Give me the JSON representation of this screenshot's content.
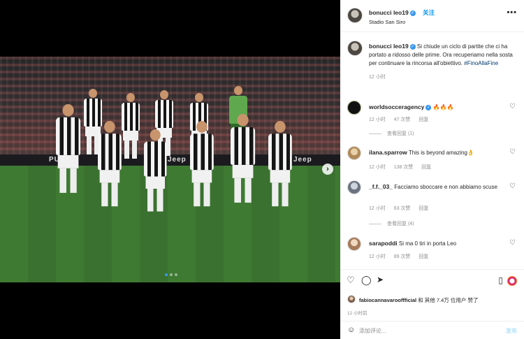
{
  "post": {
    "username": "bonucci",
    "username_full": "bonucci leo19",
    "follow_label": "关注",
    "location": "Stadio San Siro",
    "more_label": "•••"
  },
  "media": {
    "board_text_1": "PUMA",
    "board_text_2": "Jeep",
    "board_text_3": "Jeep",
    "carousel_total": 3,
    "carousel_active": 1
  },
  "caption": {
    "username": "bonucci leo19",
    "text": "Si chiude un ciclo di partite che ci ha portato a ridosso delle prime. Ora recuperiamo nella sosta per continuare la rincorsa all'obiettivo. ",
    "hashtag": "#FinoAllaFine",
    "time": "12 小时"
  },
  "comments": [
    {
      "username": "worldsocceragency",
      "text": "🔥🔥🔥",
      "time": "12 小时",
      "likes": "47 次赞",
      "reply": "回复",
      "replies": "查看回复 (1)"
    },
    {
      "username": "ilana.sparrow",
      "text": "This is beyond amazing👌",
      "time": "12 小时",
      "likes": "138 次赞",
      "reply": "回复",
      "replies": ""
    },
    {
      "username": "_f.f._03_",
      "text": "Facciamo sboccare e non abbiamo scuse",
      "time": "12 小时",
      "likes": "63 次赞",
      "reply": "回复",
      "replies": "查看回复 (4)"
    },
    {
      "username": "sarapoddi",
      "text": "Si ma 0 tiri in porta Leo",
      "time": "12 小时",
      "likes": "89 次赞",
      "reply": "回复",
      "replies": ""
    }
  ],
  "likes_bar": {
    "liker": "fabiocannavarooffficial",
    "rest": " 和 其他 7.4万 位用户 赞了"
  },
  "post_time": "12 小时前",
  "comment_box": {
    "placeholder": "添加评论...",
    "post_label": "发布"
  },
  "colors": {
    "accent": "#0095f6",
    "muted": "#8e8e8e",
    "hashtag": "#00376b"
  }
}
